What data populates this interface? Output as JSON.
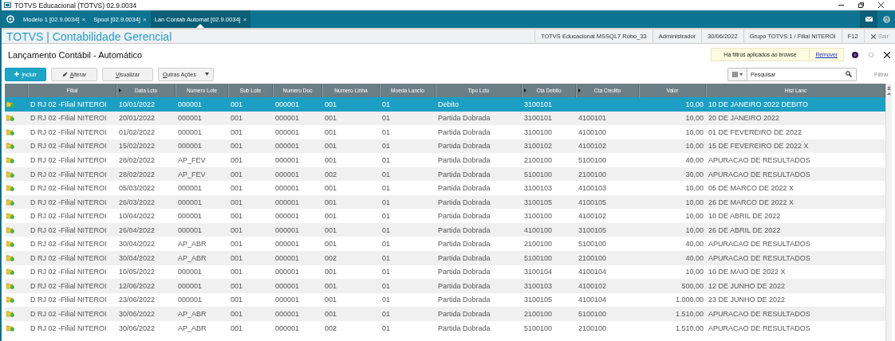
{
  "window": {
    "title": "TOTVS Educacional (TOTVS) 02.9.0034"
  },
  "tabs": [
    {
      "label": "Modelo 1 [02.9.0034]",
      "close": "×",
      "selected": false
    },
    {
      "label": "Spool [02.9.0034]",
      "close": "×",
      "selected": false
    },
    {
      "label": "Lan Contab Automat [02.9.0034]",
      "close": "×",
      "selected": true
    }
  ],
  "header": {
    "title": "TOTVS | Contabilidade Gerencial",
    "info": [
      "TOTVS Educacional MSSQL7 Robo_33",
      "Administrador",
      "30/06/2022",
      "Grupo TOTVS 1 / Filial NITEROI",
      "F12"
    ],
    "exit": {
      "label": "Sair",
      "disabled": true
    }
  },
  "page": {
    "title": "Lançamento Contábil - Automático"
  },
  "filter_notice": {
    "text": "Há filtros aplicados ao browse",
    "link": "Remover"
  },
  "actions": [
    {
      "kind": "primary",
      "label": "Incluir"
    },
    {
      "kind": "edit",
      "label": "Alterar"
    },
    {
      "kind": "plain",
      "label": "Visualizar"
    },
    {
      "kind": "menu",
      "label": "Outras Ações"
    }
  ],
  "search": {
    "placeholder": "Pesquisar",
    "filter_label": "Filtrar"
  },
  "table": {
    "columns": [
      {
        "label": "Filial",
        "marked": false
      },
      {
        "label": "Data Lcto",
        "marked": true
      },
      {
        "label": "Numero Lote",
        "marked": false
      },
      {
        "label": "Sub Lote",
        "marked": false
      },
      {
        "label": "Numero Doc",
        "marked": false
      },
      {
        "label": "Numero Linha",
        "marked": false
      },
      {
        "label": "Moeda Lancto",
        "marked": false
      },
      {
        "label": "Tipo Lcto",
        "marked": false
      },
      {
        "label": "Cta Debito",
        "marked": true
      },
      {
        "label": "Cta Credito",
        "marked": true
      },
      {
        "label": "Valor",
        "marked": false
      },
      {
        "label": "Hist Lanc",
        "marked": false
      }
    ],
    "rows": [
      {
        "selected": true,
        "cells": [
          "D RJ 02 -Filial NITEROI",
          "10/01/2022",
          "000001",
          "001",
          "000001",
          "001",
          "01",
          "Debito",
          "3100101",
          null,
          "10,00",
          "10 DE JANEIRO 2022 DEBITO"
        ]
      },
      {
        "selected": false,
        "cells": [
          "D RJ 02 -Filial NITEROI",
          "20/01/2022",
          "000001",
          "001",
          "000001",
          "001",
          "01",
          "Partida Dobrada",
          "3100101",
          "4100101",
          "10,00",
          "20 DE JANEIRO 2022"
        ]
      },
      {
        "selected": false,
        "cells": [
          "D RJ 02 -Filial NITEROI",
          "01/02/2022",
          "000001",
          "001",
          "000001",
          "001",
          "01",
          "Partida Dobrada",
          "3100100",
          "4100100",
          "10,00",
          "01 DE FEVEREIRO DE 2022"
        ]
      },
      {
        "selected": false,
        "cells": [
          "D RJ 02 -Filial NITEROI",
          "15/02/2022",
          "000001",
          "001",
          "000001",
          "001",
          "01",
          "Partida Dobrada",
          "3100102",
          "4100102",
          "10,00",
          "15 DE FEVEREIRO DE 2022 X"
        ]
      },
      {
        "selected": false,
        "cells": [
          "D RJ 02 -Filial NITEROI",
          "28/02/2022",
          "AP_FEV",
          "001",
          "000001",
          "001",
          "01",
          "Partida Dobrada",
          "2100100",
          "5100100",
          "40,00",
          "APURACAO DE RESULTADOS"
        ]
      },
      {
        "selected": false,
        "cells": [
          "D RJ 02 -Filial NITEROI",
          "28/02/2022",
          "AP_FEV",
          "001",
          "000001",
          "002",
          "01",
          "Partida Dobrada",
          "5100100",
          "2100100",
          "30,00",
          "APURACAO DE RESULTADOS"
        ]
      },
      {
        "selected": false,
        "cells": [
          "D RJ 02 -Filial NITEROI",
          "05/03/2022",
          "000001",
          "001",
          "000001",
          "001",
          "01",
          "Partida Dobrada",
          "3100103",
          "4100103",
          "10,00",
          "05 DE MARCO DE 2022 X"
        ]
      },
      {
        "selected": false,
        "cells": [
          "D RJ 02 -Filial NITEROI",
          "26/03/2022",
          "000001",
          "001",
          "000001",
          "001",
          "01",
          "Partida Dobrada",
          "3100105",
          "4100105",
          "10,00",
          "26 DE MARCO DE 2022 X"
        ]
      },
      {
        "selected": false,
        "cells": [
          "D RJ 02 -Filial NITEROI",
          "10/04/2022",
          "000001",
          "001",
          "000001",
          "001",
          "01",
          "Partida Dobrada",
          "3100100",
          "4100102",
          "10,00",
          "10 DE ABRIL DE 2022"
        ]
      },
      {
        "selected": false,
        "cells": [
          "D RJ 02 -Filial NITEROI",
          "26/04/2022",
          "000001",
          "001",
          "000001",
          "001",
          "01",
          "Partida Dobrada",
          "4100100",
          "3100105",
          "10,00",
          "26 DE ABRIL DE 2022"
        ]
      },
      {
        "selected": false,
        "cells": [
          "D RJ 02 -Filial NITEROI",
          "30/04/2022",
          "AP_ABR",
          "001",
          "000001",
          "001",
          "01",
          "Partida Dobrada",
          "2100100",
          "5100100",
          "40,00",
          "APURACAO DE RESULTADOS"
        ]
      },
      {
        "selected": false,
        "cells": [
          "D RJ 02 -Filial NITEROI",
          "30/04/2022",
          "AP_ABR",
          "001",
          "000001",
          "002",
          "01",
          "Partida Dobrada",
          "5100100",
          "2100100",
          "40,00",
          "APURACAO DE RESULTADOS"
        ]
      },
      {
        "selected": false,
        "cells": [
          "D RJ 02 -Filial NITEROI",
          "10/05/2022",
          "000001",
          "001",
          "000001",
          "001",
          "01",
          "Partida Dobrada",
          "3100104",
          "4100104",
          "10,00",
          "10 DE MAIO DE 2022 X"
        ]
      },
      {
        "selected": false,
        "cells": [
          "D RJ 02 -Filial NITEROI",
          "12/06/2022",
          "000001",
          "001",
          "000001",
          "001",
          "01",
          "Partida Dobrada",
          "3100103",
          "4100102",
          "500,00",
          "12 DE JUNHO DE 2022"
        ]
      },
      {
        "selected": false,
        "cells": [
          "D RJ 02 -Filial NITEROI",
          "23/06/2022",
          "000001",
          "001",
          "000001",
          "001",
          "01",
          "Partida Dobrada",
          "3100105",
          "4100104",
          "1.000,00",
          "23 DE JUNHO DE 2022"
        ]
      },
      {
        "selected": false,
        "cells": [
          "D RJ 02 -Filial NITEROI",
          "30/06/2022",
          "AP_ABR",
          "001",
          "000001",
          "001",
          "01",
          "Partida Dobrada",
          "2100100",
          "5100100",
          "1.510,00",
          "APURACAO DE RESULTADOS"
        ]
      },
      {
        "selected": false,
        "cells": [
          "D RJ 02 -Filial NITEROI",
          "30/06/2022",
          "AP_ABR",
          "001",
          "000001",
          "002",
          "01",
          "Partida Dobrada",
          "5100100",
          "2100100",
          "1.510,00",
          "APURACAO DE RESULTADOS"
        ]
      }
    ]
  }
}
